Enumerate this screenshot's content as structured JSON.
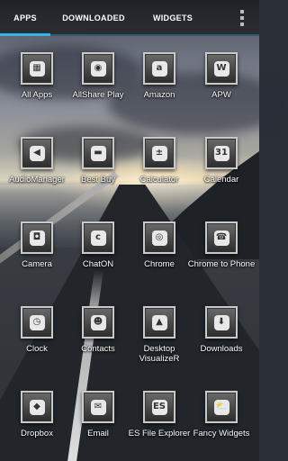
{
  "tabs": [
    {
      "label": "APPS",
      "active": true
    },
    {
      "label": "DOWNLOADED",
      "active": false
    },
    {
      "label": "WIDGETS",
      "active": false
    }
  ],
  "overflow_menu_icon": "overflow-menu-icon",
  "accent_color": "#33b5e5",
  "apps": [
    {
      "label": "All Apps",
      "icon": "grid-icon",
      "glyph": "▦"
    },
    {
      "label": "AllShare Play",
      "icon": "allshare-icon",
      "glyph": "◉"
    },
    {
      "label": "Amazon",
      "icon": "amazon-icon",
      "glyph": "a"
    },
    {
      "label": "APW",
      "icon": "apw-icon",
      "glyph": "W"
    },
    {
      "label": "AudioManager",
      "icon": "speaker-icon",
      "glyph": "◀"
    },
    {
      "label": "Best Buy",
      "icon": "bestbuy-tag-icon",
      "glyph": "▬"
    },
    {
      "label": "Calculator",
      "icon": "calculator-icon",
      "glyph": "±"
    },
    {
      "label": "Calendar",
      "icon": "calendar-icon",
      "glyph": "31"
    },
    {
      "label": "Camera",
      "icon": "camera-icon",
      "glyph": "◘"
    },
    {
      "label": "ChatON",
      "icon": "chat-bubble-icon",
      "glyph": "c"
    },
    {
      "label": "Chrome",
      "icon": "chrome-icon",
      "glyph": "◎"
    },
    {
      "label": "Chrome to Phone",
      "icon": "phone-icon",
      "glyph": "☎"
    },
    {
      "label": "Clock",
      "icon": "clock-icon",
      "glyph": "◷"
    },
    {
      "label": "Contacts",
      "icon": "contacts-icon",
      "glyph": "☻"
    },
    {
      "label": "Desktop VisualizeR",
      "icon": "visualizer-icon",
      "glyph": "▲"
    },
    {
      "label": "Downloads",
      "icon": "download-icon",
      "glyph": "⬇"
    },
    {
      "label": "Dropbox",
      "icon": "dropbox-icon",
      "glyph": "◆"
    },
    {
      "label": "Email",
      "icon": "email-icon",
      "glyph": "✉"
    },
    {
      "label": "ES File Explorer",
      "icon": "folder-icon",
      "glyph": "ES"
    },
    {
      "label": "Fancy Widgets",
      "icon": "fancy-widgets-icon",
      "glyph": "⛅"
    }
  ]
}
